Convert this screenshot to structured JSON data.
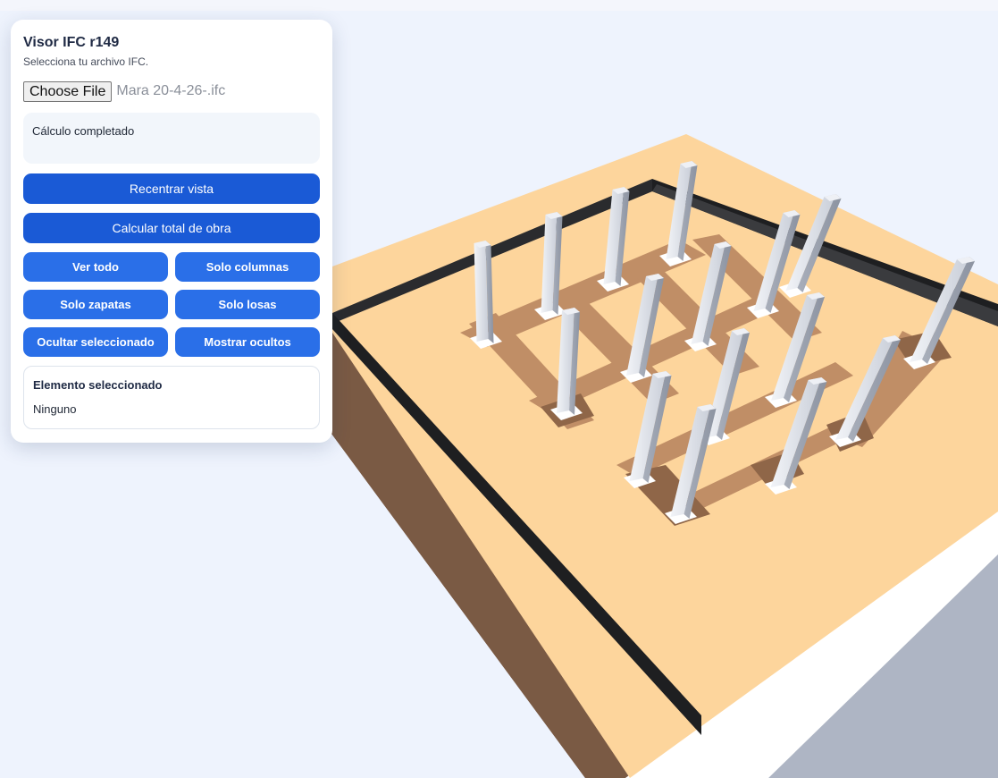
{
  "panel": {
    "title": "Visor IFC r149",
    "subtitle": "Selecciona tu archivo IFC.",
    "file_button_label": "Choose File",
    "file_name": "Mara 20-4-26-.ifc",
    "status_text": "Cálculo completado",
    "recenter_label": "Recentrar vista",
    "calculate_label": "Calcular total de obra",
    "filter_buttons": {
      "ver_todo": "Ver todo",
      "solo_columnas": "Solo columnas",
      "solo_zapatas": "Solo zapatas",
      "solo_losas": "Solo losas",
      "ocultar": "Ocultar seleccionado",
      "mostrar": "Mostrar ocultos"
    },
    "selection": {
      "title": "Elemento seleccionado",
      "value": "Ninguno"
    }
  },
  "scene": {
    "background_color": "#eef3fd",
    "slab_top_color": "#fdd59c",
    "slab_side_color": "#7a5a44",
    "wall_color": "#1e1f21",
    "column_color": "#c8cdd6",
    "footing_hole_color": "#b98a63",
    "ground_color": "#aeb5c4",
    "column_count": 16
  }
}
